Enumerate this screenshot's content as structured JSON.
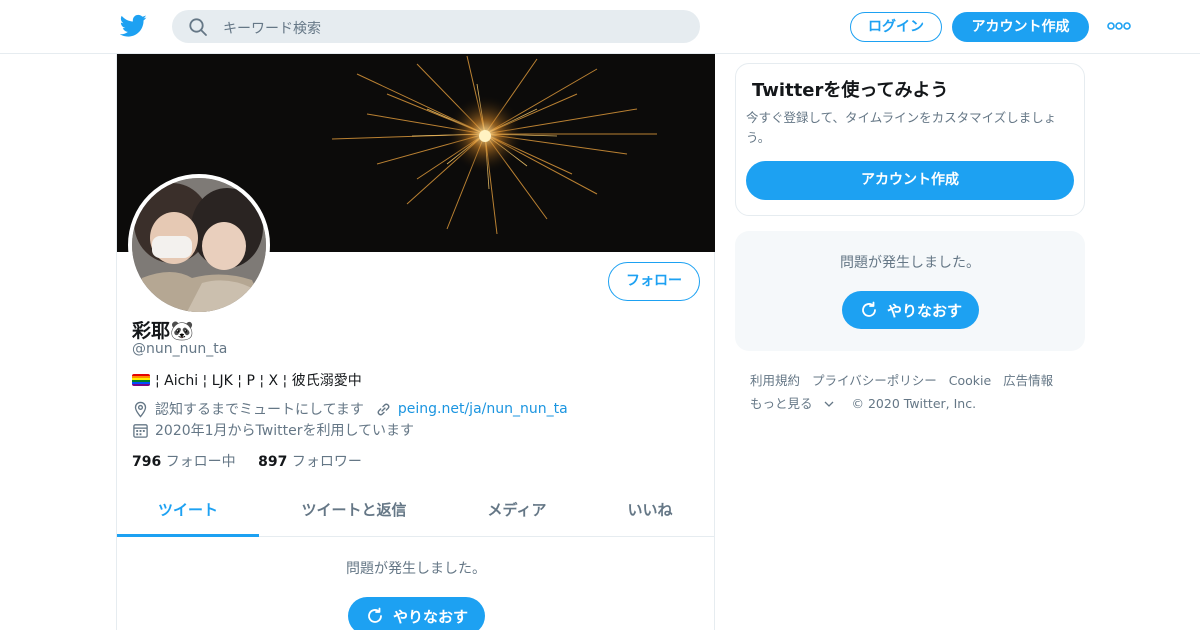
{
  "header": {
    "search_placeholder": "キーワード検索",
    "login_label": "ログイン",
    "signup_label": "アカウント作成"
  },
  "profile": {
    "name": "彩耶🐼",
    "handle": "@nun_nun_ta",
    "bio": "¦ Aichi ¦ LJK ¦ P ¦ X ¦ 彼氏溺愛中",
    "location": "認知するまでミュートにしてます",
    "website": "peing.net/ja/nun_nun_ta",
    "joined": "2020年1月からTwitterを利用しています",
    "following_count": "796",
    "following_label": "フォロー中",
    "followers_count": "897",
    "followers_label": "フォロワー",
    "follow_button": "フォロー"
  },
  "tabs": [
    {
      "label": "ツイート",
      "active": true
    },
    {
      "label": "ツイートと返信",
      "active": false
    },
    {
      "label": "メディア",
      "active": false
    },
    {
      "label": "いいね",
      "active": false
    }
  ],
  "timeline": {
    "error_message": "問題が発生しました。",
    "retry_label": "やりなおす"
  },
  "sidebar": {
    "try_title": "Twitterを使ってみよう",
    "try_desc": "今すぐ登録して、タイムラインをカスタマイズしましょう。",
    "create_account_label": "アカウント作成",
    "error_message": "問題が発生しました。",
    "retry_label": "やりなおす"
  },
  "footer": {
    "links": [
      "利用規約",
      "プライバシーポリシー",
      "Cookie",
      "広告情報"
    ],
    "more_label": "もっと見る",
    "copyright": "© 2020 Twitter, Inc."
  },
  "colors": {
    "accent": "#1da1f2",
    "text_secondary": "#657786",
    "border": "#e6ecf0"
  }
}
